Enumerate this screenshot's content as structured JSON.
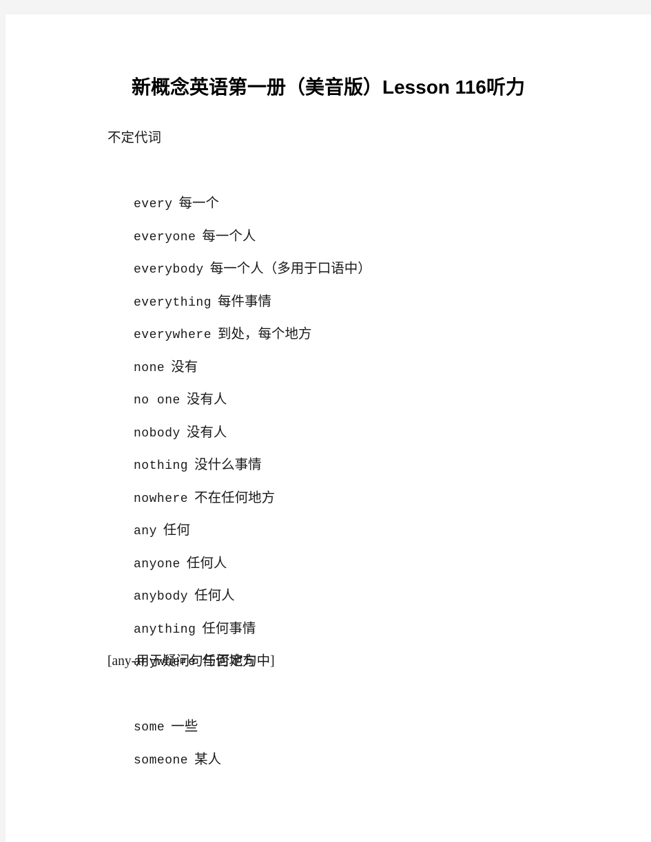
{
  "page": {
    "background_color": "#f4f4f4",
    "sheet_color": "#ffffff",
    "text_color": "#1a1a1a"
  },
  "document": {
    "title": "新概念英语第一册（美音版）Lesson 116听力",
    "section_heading": "不定代词",
    "entries": [
      {
        "term": "every",
        "gloss": "每一个"
      },
      {
        "term": "everyone",
        "gloss": "每一个人"
      },
      {
        "term": "everybody",
        "gloss": "每一个人（多用于口语中）"
      },
      {
        "term": "everything",
        "gloss": "每件事情"
      },
      {
        "term": "everywhere",
        "gloss": "到处，每个地方"
      },
      {
        "term": "none",
        "gloss": "没有"
      },
      {
        "term": "no one",
        "gloss": "没有人"
      },
      {
        "term": "nobody",
        "gloss": "没有人"
      },
      {
        "term": "nothing",
        "gloss": "没什么事情"
      },
      {
        "term": "nowhere",
        "gloss": "不在任何地方"
      },
      {
        "term": "any",
        "gloss": "任何"
      },
      {
        "term": "anyone",
        "gloss": "任何人"
      },
      {
        "term": "anybody",
        "gloss": "任何人"
      },
      {
        "term": "anything",
        "gloss": "任何事情"
      },
      {
        "term": "anywhere",
        "gloss": "任何地方"
      }
    ],
    "usage_note": "[any-用于疑问句与否定句中]",
    "entries_after_note": [
      {
        "term": "some",
        "gloss": "一些"
      },
      {
        "term": "someone",
        "gloss": "某人"
      }
    ]
  }
}
